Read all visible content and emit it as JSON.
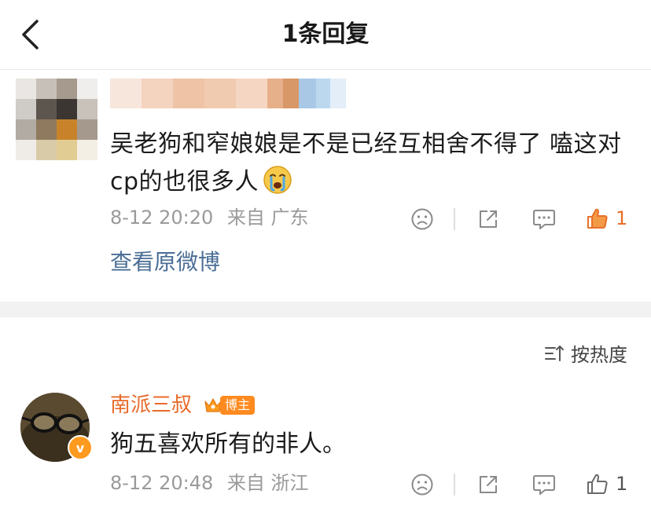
{
  "header": {
    "title": "1条回复"
  },
  "original_comment": {
    "text": "吴老狗和窄娘娘是不是已经互相舍不得了 嗑这对cp的也很多人",
    "date": "8-12 20:20",
    "location": "来自 广东",
    "like_count": "1",
    "view_link": "查看原微博",
    "emoji_icon": "crying-face-icon"
  },
  "sort": {
    "label": "按热度"
  },
  "reply": {
    "author": "南派三叔",
    "badge_label": "博主",
    "verified_mark": "v",
    "text": "狗五喜欢所有的非人。",
    "date": "8-12 20:48",
    "location": "来自 浙江",
    "like_count": "1"
  },
  "colors": {
    "link": "#4a6e95",
    "author": "#e86a2a",
    "accent": "#ff8a1f",
    "meta": "#9a9a9a"
  }
}
